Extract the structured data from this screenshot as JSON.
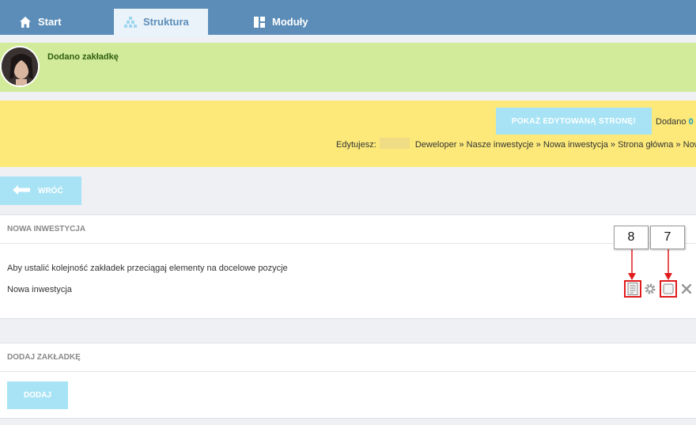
{
  "nav": {
    "tabs": [
      {
        "label": "Start",
        "icon": "home-icon"
      },
      {
        "label": "Struktura",
        "icon": "sitemap-icon",
        "active": true
      },
      {
        "label": "Moduły",
        "icon": "modules-icon"
      }
    ]
  },
  "notice": {
    "message": "Dodano zakładkę"
  },
  "editbar": {
    "show_button": "POKAŻ EDYTOWANĄ STRONĘ!",
    "added_label": "Dodano",
    "added_value": "0",
    "editing_label": "Edytujesz:",
    "breadcrumb": [
      "Deweloper",
      "Nasze inwestycje",
      "Nowa inwestycja",
      "Strona główna",
      "Now"
    ],
    "breadcrumb_sep": "»"
  },
  "back_button": "WRÓĆ",
  "tabs_panel": {
    "title": "NOWA INWESTYCJA",
    "help_text": "Aby ustalić kolejność zakładek przeciągaj elementy na docelowe pozycje",
    "item_label": "Nowa inwestycja"
  },
  "add_panel": {
    "title": "DODAJ ZAKŁADKĘ",
    "add_button": "DODAJ"
  },
  "callouts": {
    "left": "8",
    "right": "7"
  },
  "colors": {
    "nav": "#5b8db8",
    "notice": "#d2eb9a",
    "editbar": "#fce97a",
    "button": "#a8e3f5",
    "highlight": "#e11b1b"
  }
}
